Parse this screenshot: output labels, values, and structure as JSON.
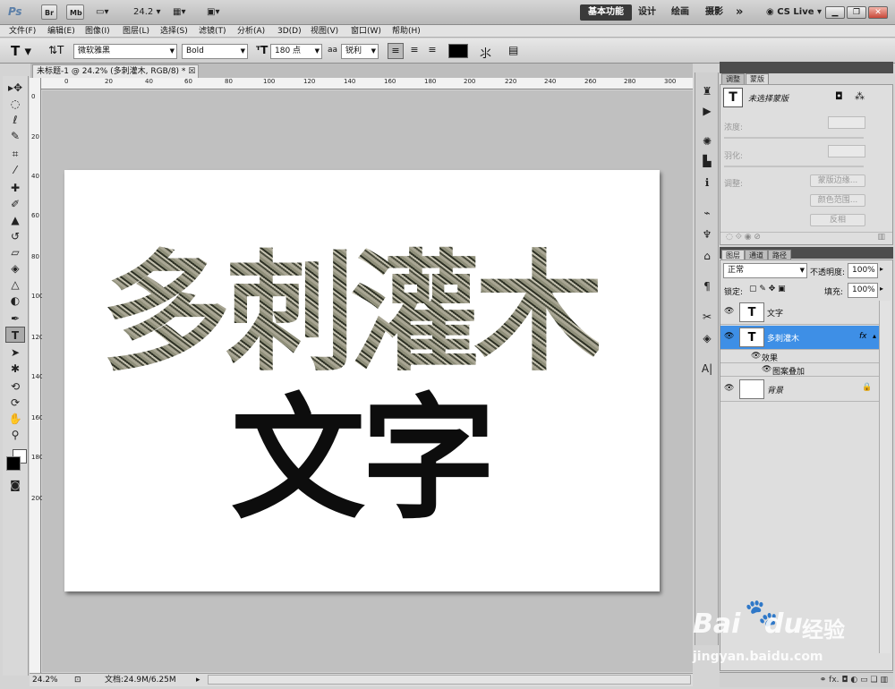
{
  "appbar": {
    "logo": "Ps",
    "br": "Br",
    "mb": "Mb",
    "zoom": "24.2",
    "ws_active": "基本功能",
    "ws_design": "设计",
    "ws_paint": "绘画",
    "ws_photo": "摄影",
    "more": "»",
    "cslive": "CS Live"
  },
  "menu": [
    "文件(F)",
    "编辑(E)",
    "图像(I)",
    "图层(L)",
    "选择(S)",
    "滤镜(T)",
    "分析(A)",
    "3D(D)",
    "视图(V)",
    "窗口(W)",
    "帮助(H)"
  ],
  "options": {
    "font_family": "微软雅黑",
    "font_style": "Bold",
    "font_size": "180 点",
    "aa_label": "aa",
    "aa_value": "锐利"
  },
  "document": {
    "tab": "未标题-1 @ 24.2% (多刺灌木, RGB/8) *",
    "line1": "多刺灌木",
    "line2": "文字"
  },
  "rulers": {
    "h": [
      "0",
      "20",
      "40",
      "60",
      "80",
      "100",
      "120",
      "140",
      "160",
      "180",
      "200",
      "220",
      "240",
      "260",
      "280",
      "300"
    ],
    "v": [
      "0",
      "20",
      "40",
      "60",
      "80",
      "100",
      "120",
      "140",
      "160",
      "180",
      "200"
    ]
  },
  "status": {
    "zoom": "24.2%",
    "doc": "文档:24.9M/6.25M"
  },
  "masks": {
    "tab_adjust": "调整",
    "tab_mask": "蒙版",
    "title": "未选择蒙版",
    "density": "浓度:",
    "feather": "羽化:",
    "refine": "调整:",
    "btn_edge": "蒙版边缘...",
    "btn_color": "颜色范围...",
    "btn_invert": "反相"
  },
  "layers": {
    "tab_layers": "图层",
    "tab_channels": "通道",
    "tab_paths": "路径",
    "blend": "正常",
    "opacity_label": "不透明度:",
    "opacity": "100%",
    "lock_label": "锁定:",
    "fill_label": "填充:",
    "fill": "100%",
    "items": [
      {
        "name": "文字",
        "thumb": "T"
      },
      {
        "name": "多刺灌木",
        "thumb": "T",
        "fx": "fx"
      },
      {
        "name": "效果"
      },
      {
        "name": "图案叠加"
      },
      {
        "name": "背景"
      }
    ]
  },
  "watermark": {
    "brand": "Bai",
    "brand2": "du",
    "cn": "经验",
    "url": "jingyan.baidu.com"
  },
  "colors": {
    "selected": "#3e8fe6",
    "active_ws": "#3a3a3a"
  }
}
